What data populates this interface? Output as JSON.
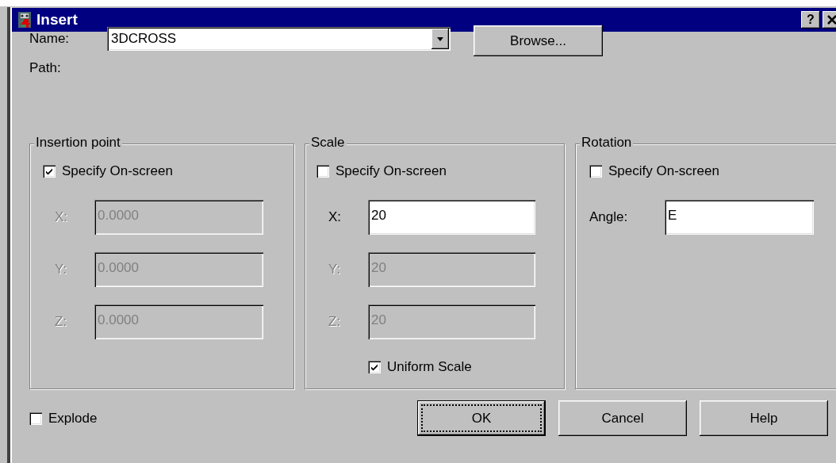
{
  "window": {
    "title": "Insert",
    "help_button": "?"
  },
  "name": {
    "label": "Name:",
    "value": "3DCROSS"
  },
  "browse_button": "Browse...",
  "path": {
    "label": "Path:"
  },
  "groups": [
    {
      "title": "Insertion point",
      "specify": {
        "label": "Specify On-screen",
        "checked": true
      },
      "fields": [
        {
          "label": "X:",
          "value": "0.0000",
          "disabled": true
        },
        {
          "label": "Y:",
          "value": "0.0000",
          "disabled": true
        },
        {
          "label": "Z:",
          "value": "0.0000",
          "disabled": true
        }
      ]
    },
    {
      "title": "Scale",
      "specify": {
        "label": "Specify On-screen",
        "checked": false
      },
      "fields": [
        {
          "label": "X:",
          "value": "20",
          "disabled": false
        },
        {
          "label": "Y:",
          "value": "20",
          "disabled": true
        },
        {
          "label": "Z:",
          "value": "20",
          "disabled": true
        }
      ],
      "uniform": {
        "label": "Uniform Scale",
        "checked": true
      }
    },
    {
      "title": "Rotation",
      "specify": {
        "label": "Specify On-screen",
        "checked": false
      },
      "fields": [
        {
          "label": "Angle:",
          "value": "E",
          "disabled": false
        }
      ]
    }
  ],
  "explode": {
    "label": "Explode",
    "checked": false
  },
  "buttons": [
    {
      "label": "OK",
      "focused": true
    },
    {
      "label": "Cancel",
      "focused": false
    },
    {
      "label": "Help",
      "focused": false
    }
  ]
}
